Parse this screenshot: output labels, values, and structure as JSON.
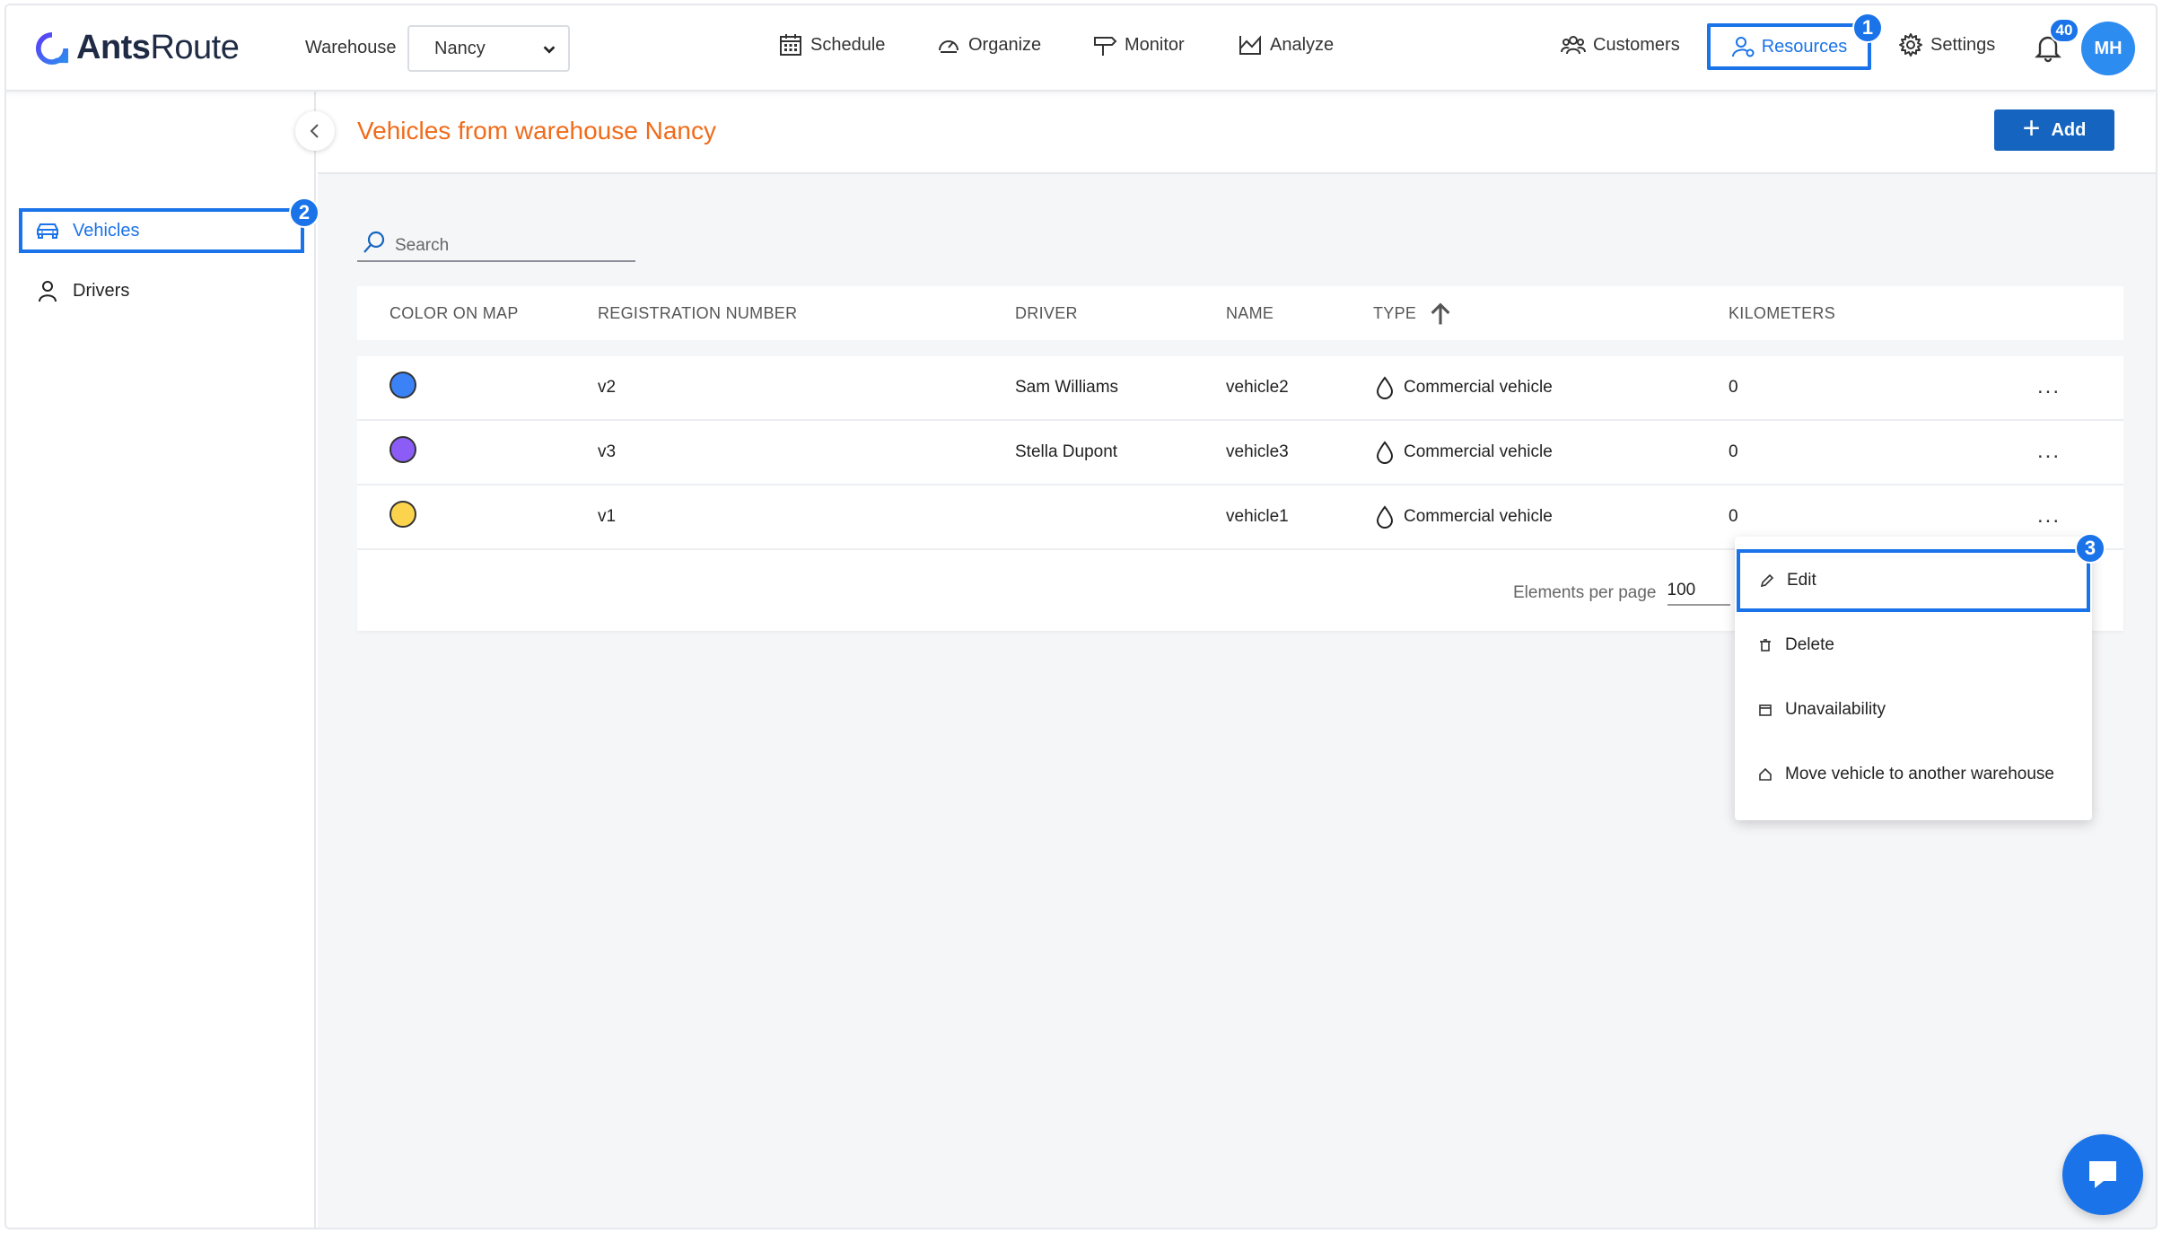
{
  "app": {
    "logo_strong": "Ants",
    "logo_rest": "Route"
  },
  "header": {
    "warehouse_label": "Warehouse",
    "warehouse_value": "Nancy",
    "nav": {
      "schedule": "Schedule",
      "organize": "Organize",
      "monitor": "Monitor",
      "analyze": "Analyze",
      "customers": "Customers",
      "resources": "Resources",
      "settings": "Settings"
    },
    "notification_count": "40",
    "avatar_initials": "MH"
  },
  "badges": {
    "step1": "1",
    "step2": "2",
    "step3": "3"
  },
  "sidebar": {
    "items": [
      {
        "label": "Vehicles",
        "active": true
      },
      {
        "label": "Drivers",
        "active": false
      }
    ]
  },
  "main": {
    "title": "Vehicles from warehouse Nancy",
    "add_label": "Add",
    "search_placeholder": "Search"
  },
  "table": {
    "headers": [
      "COLOR ON MAP",
      "REGISTRATION NUMBER",
      "DRIVER",
      "NAME",
      "TYPE",
      "KILOMETERS"
    ],
    "rows": [
      {
        "color": "#3b82f6",
        "registration": "v2",
        "driver": "Sam Williams",
        "name": "vehicle2",
        "type": "Commercial vehicle",
        "km": "0"
      },
      {
        "color": "#8b5cf6",
        "registration": "v3",
        "driver": "Stella Dupont",
        "name": "vehicle3",
        "type": "Commercial vehicle",
        "km": "0"
      },
      {
        "color": "#fcd34d",
        "registration": "v1",
        "driver": "",
        "name": "vehicle1",
        "type": "Commercial vehicle",
        "km": "0"
      }
    ],
    "more_label": "...",
    "per_page_label": "Elements per page",
    "per_page_value": "100"
  },
  "context_menu": {
    "items": [
      "Edit",
      "Delete",
      "Unavailability",
      "Move vehicle to another warehouse"
    ]
  },
  "colors": {
    "accent": "#1a73e8",
    "title": "#f06b1a",
    "add_button": "#1565c0"
  }
}
